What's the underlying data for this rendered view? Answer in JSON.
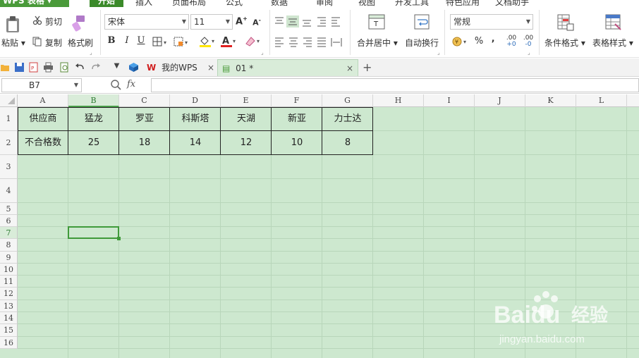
{
  "menu": {
    "app_label": "WPS 表格",
    "items": [
      "开始",
      "插入",
      "页面布局",
      "公式",
      "数据",
      "审阅",
      "视图",
      "开发工具",
      "特色应用",
      "文档助手"
    ]
  },
  "ribbon": {
    "paste_label": "粘贴",
    "cut_label": "剪切",
    "copy_label": "复制",
    "format_painter_label": "格式刷",
    "font_name": "宋体",
    "font_size": "11",
    "bold": "B",
    "italic": "I",
    "underline": "U",
    "merge_center_label": "合并居中",
    "wrap_text_label": "自动换行",
    "number_format": "常规",
    "conditional_format_label": "条件格式",
    "table_style_label": "表格样式",
    "percent": "%",
    "comma": "‚",
    "inc_decimal": ".00",
    "dec_decimal": ".00"
  },
  "tabs": {
    "wps_tab_label": "我的WPS",
    "doc_tab_label": "01 *",
    "add_tab": "+"
  },
  "formula_bar": {
    "cell_ref": "B7",
    "fx_label": "fx",
    "content": ""
  },
  "grid": {
    "columns": [
      "A",
      "B",
      "C",
      "D",
      "E",
      "F",
      "G",
      "H",
      "I",
      "J",
      "K",
      "L"
    ],
    "rows": [
      "1",
      "2",
      "3",
      "4",
      "5",
      "6",
      "7",
      "8",
      "9",
      "10",
      "11",
      "12",
      "13",
      "14",
      "15",
      "16"
    ],
    "active_column": "B",
    "active_row": "7",
    "table": [
      [
        "供应商",
        "猛龙",
        "罗亚",
        "科斯塔",
        "天湖",
        "新亚",
        "力士达"
      ],
      [
        "不合格数",
        "25",
        "18",
        "14",
        "12",
        "10",
        "8"
      ]
    ]
  },
  "watermark": {
    "brand": "Baidu",
    "brand_cn": "经验",
    "url": "jingyan.baidu.com"
  },
  "colors": {
    "accent": "#4a9a3a",
    "grid_bg": "#cde8cf"
  }
}
